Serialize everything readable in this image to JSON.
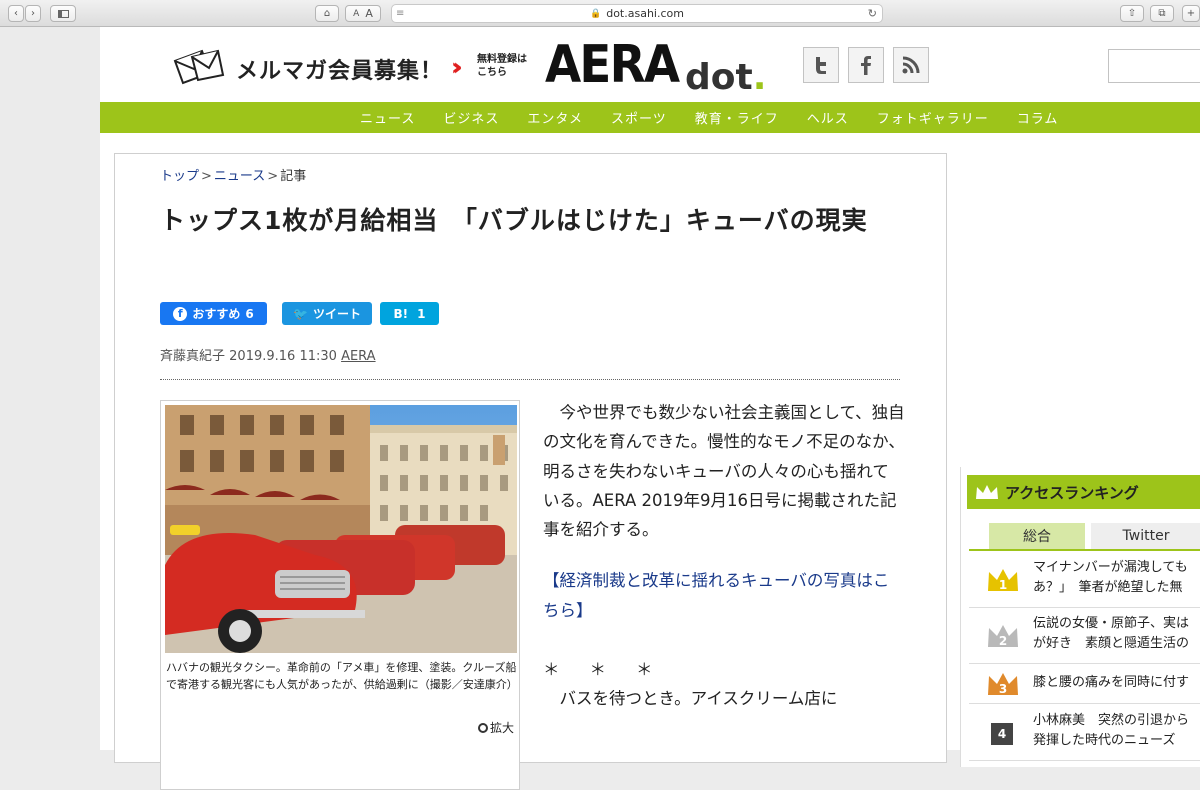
{
  "browser": {
    "url": "dot.asahi.com",
    "text_size_small": "A",
    "text_size_large": "A"
  },
  "header": {
    "mail_text": "メルマガ会員募集！",
    "register_line1": "無料登録は",
    "register_line2": "こちら",
    "logo_main": "AERA",
    "logo_dot_text": "dot",
    "logo_dot_period": ".",
    "social": [
      "twitter-icon",
      "facebook-icon",
      "rss-icon"
    ]
  },
  "nav": {
    "items": [
      "ニュース",
      "ビジネス",
      "エンタメ",
      "スポーツ",
      "教育・ライフ",
      "ヘルス",
      "フォトギャラリー",
      "コラム"
    ]
  },
  "article": {
    "breadcrumb": [
      "トップ",
      "ニュース",
      "記事"
    ],
    "title": "トップス1枚が月給相当　「バブルはじけた」キューバの現実",
    "share": {
      "facebook_label": "おすすめ",
      "facebook_count": "6",
      "tweet_label": "ツイート",
      "hatena_label": "B!",
      "hatena_count": "1"
    },
    "author": "斉藤真紀子",
    "date": "2019.9.16 11:30",
    "source": "AERA",
    "caption": "ハバナの観光タクシー。革命前の「アメ車」を修理、塗装。クルーズ船で寄港する観光客にも人気があったが、供給過剰に（撮影／安達康介）",
    "zoom_label": "拡大",
    "paragraph1": "　今や世界でも数少ない社会主義国として、独自の文化を育んできた。慢性的なモノ不足のなか、明るさを失わないキューバの人々の心も揺れている。AERA 2019年9月16日号に掲載された記事を紹介する。",
    "photo_link": "【経済制裁と改革に揺れるキューバの写真はこちら】",
    "stars": "＊＊＊",
    "paragraph2": "　バスを待つとき。アイスクリーム店に"
  },
  "ranking": {
    "title": "アクセスランキング",
    "tabs": [
      "総合",
      "Twitter"
    ],
    "items": [
      {
        "rank": "1",
        "text1": "マイナンバーが漏洩しても",
        "text2": "あ？」　筆者が絶望した無"
      },
      {
        "rank": "2",
        "text1": "伝説の女優・原節子、実は",
        "text2": "が好き　素顔と隠遁生活の"
      },
      {
        "rank": "3",
        "text1": "膝と腰の痛みを同時に付す",
        "text2": ""
      },
      {
        "rank": "4",
        "text1": "小林麻美　突然の引退から",
        "text2": "発揮した時代のニューズ"
      }
    ]
  },
  "colors": {
    "accent_green": "#9dc41a",
    "link_blue": "#1a3a8a",
    "facebook": "#1877f2",
    "twitter": "#1b95e0",
    "hatena": "#00a4de",
    "gold": "#e6c200",
    "silver": "#b9b9b9",
    "bronze": "#e08a2c"
  }
}
